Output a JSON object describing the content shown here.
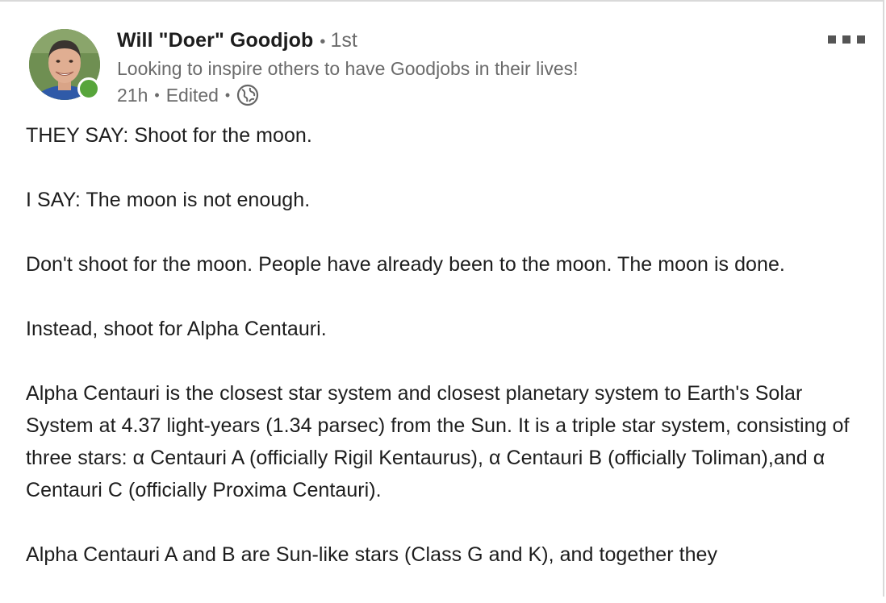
{
  "author": {
    "name": "Will \"Doer\" Goodjob",
    "degree": "1st",
    "headline": "Looking to inspire others to have Goodjobs in their lives!",
    "time": "21h",
    "edited": "Edited",
    "separator": "•",
    "visibility_icon": "globe-icon",
    "presence_color": "#57a53b"
  },
  "menu": {
    "icon": "more-options-icon"
  },
  "post": {
    "paragraphs": [
      "THEY SAY: Shoot for the moon.",
      "I SAY: The moon is not enough.",
      "Don't shoot for the moon. People have already been to the moon. The moon is done.",
      "Instead, shoot for Alpha Centauri.",
      "Alpha Centauri is the closest star system and closest planetary system to Earth's Solar System at 4.37 light-years (1.34 parsec) from the Sun. It is a triple star system, consisting of three stars: α Centauri A (officially Rigil Kentaurus), α Centauri B (officially Toliman),and α Centauri C (officially Proxima Centauri).",
      "Alpha Centauri A and B are Sun-like stars (Class G and K), and together they"
    ]
  }
}
